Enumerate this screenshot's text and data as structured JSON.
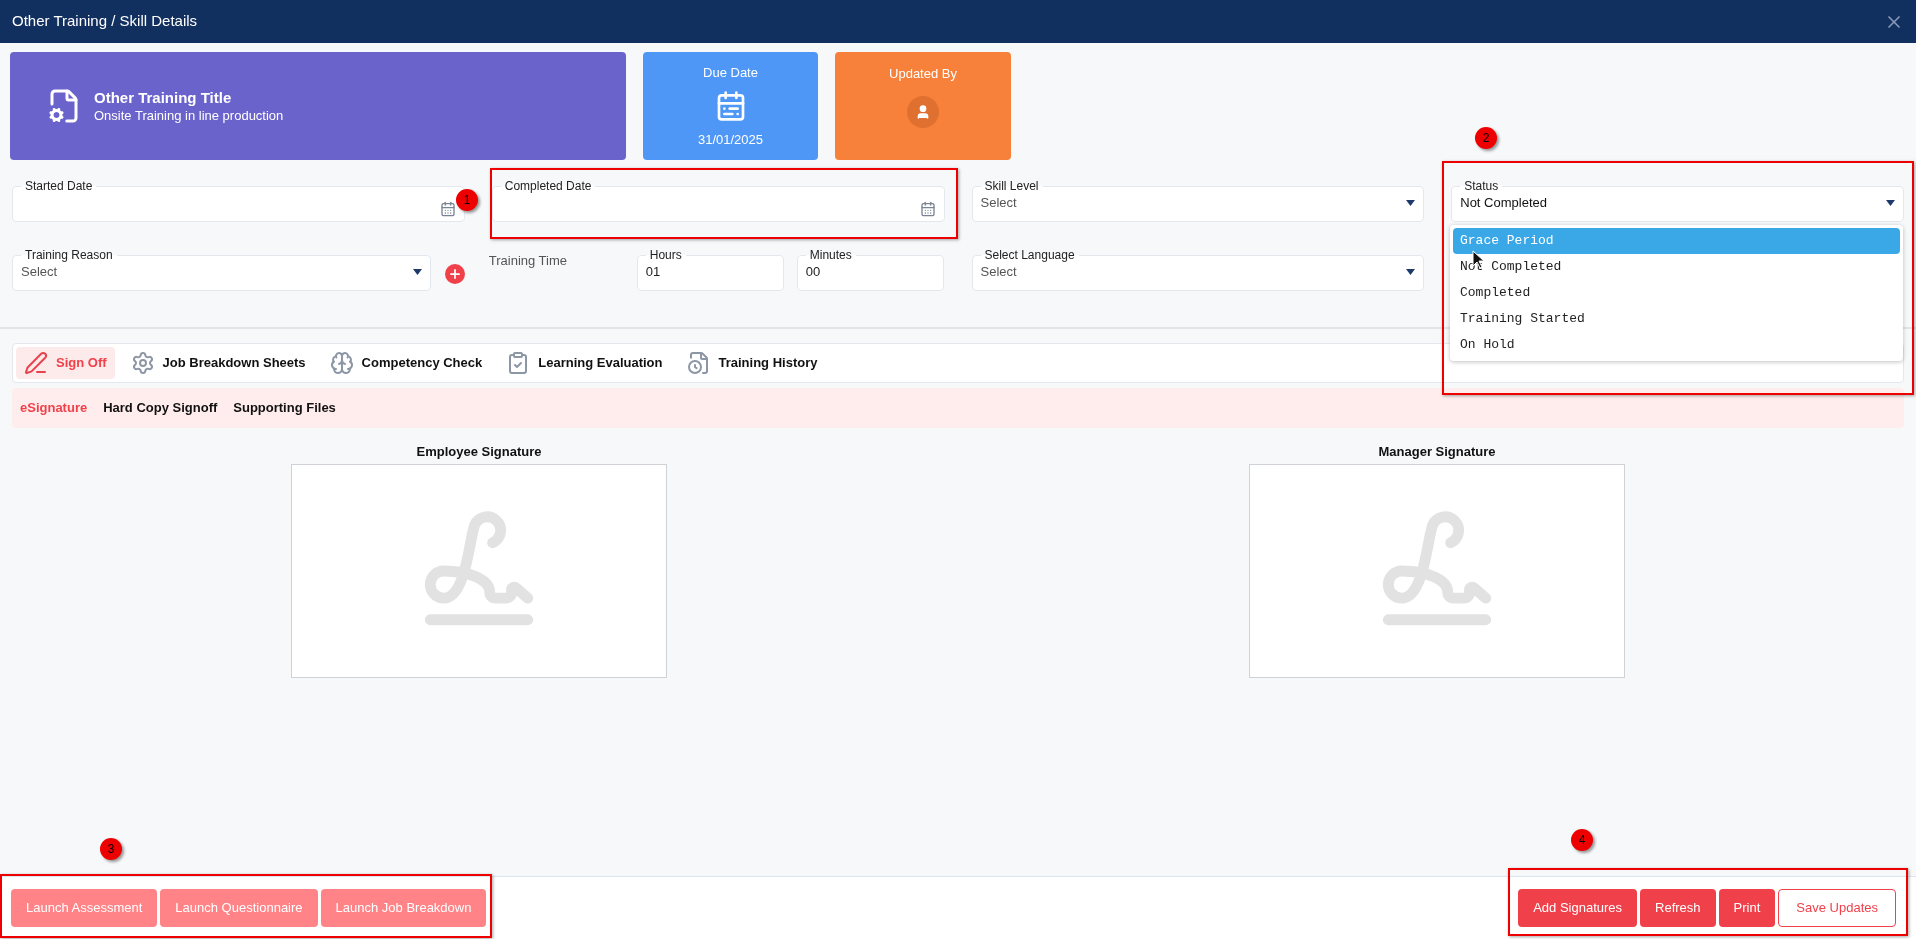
{
  "dialog": {
    "title": "Other Training / Skill Details"
  },
  "summary_cards": [
    {
      "kind": "title",
      "heading": "Other Training Title",
      "subtitle": "Onsite Training in line production",
      "color": "#6b63cc"
    },
    {
      "kind": "due",
      "heading": "Due Date",
      "value": "31/01/2025",
      "color": "#4f97f7"
    },
    {
      "kind": "user",
      "heading": "Updated By",
      "color": "#f7813a"
    }
  ],
  "row_one": [
    {
      "kind": "date",
      "label": "Started Date"
    },
    {
      "kind": "date",
      "label": "Completed Date"
    },
    {
      "kind": "select",
      "label": "Skill Level",
      "value": "Select"
    },
    {
      "kind": "select",
      "label": "Status",
      "value": "Not Completed"
    }
  ],
  "status_options": [
    {
      "label": "Grace Period",
      "selected": true
    },
    {
      "label": "Not Completed",
      "selected": false
    },
    {
      "label": "Completed",
      "selected": false
    },
    {
      "label": "Training Started",
      "selected": false
    },
    {
      "label": "On Hold",
      "selected": false
    }
  ],
  "training_reason": {
    "label": "Training Reason",
    "value": "Select"
  },
  "training_time": {
    "label": "Training Time",
    "hours": {
      "label": "Hours",
      "value": "01"
    },
    "minutes": {
      "label": "Minutes",
      "value": "00"
    }
  },
  "select_language": {
    "label": "Select Language",
    "value": "Select"
  },
  "tabs": [
    {
      "label": "Sign Off",
      "selected": true
    },
    {
      "label": "Job Breakdown Sheets",
      "selected": false
    },
    {
      "label": "Competency Check",
      "selected": false
    },
    {
      "label": "Learning Evaluation",
      "selected": false
    },
    {
      "label": "Training History",
      "selected": false
    }
  ],
  "sub_tabs": [
    {
      "label": "eSignature",
      "selected": true
    },
    {
      "label": "Hard Copy Signoff",
      "selected": false
    },
    {
      "label": "Supporting Files",
      "selected": false
    }
  ],
  "signatures": [
    {
      "label": "Employee Signature"
    },
    {
      "label": "Manager Signature"
    }
  ],
  "footer_left_buttons": [
    {
      "label": "Launch Assessment"
    },
    {
      "label": "Launch Questionnaire"
    },
    {
      "label": "Launch Job Breakdown"
    }
  ],
  "footer_right_buttons": [
    {
      "label": "Add Signatures",
      "kind": "solid"
    },
    {
      "label": "Refresh",
      "kind": "solid"
    },
    {
      "label": "Print",
      "kind": "solid"
    },
    {
      "label": "Save Updates",
      "kind": "outline"
    }
  ],
  "annotations": [
    {
      "number": "1"
    },
    {
      "number": "2"
    },
    {
      "number": "3"
    },
    {
      "number": "4"
    }
  ]
}
